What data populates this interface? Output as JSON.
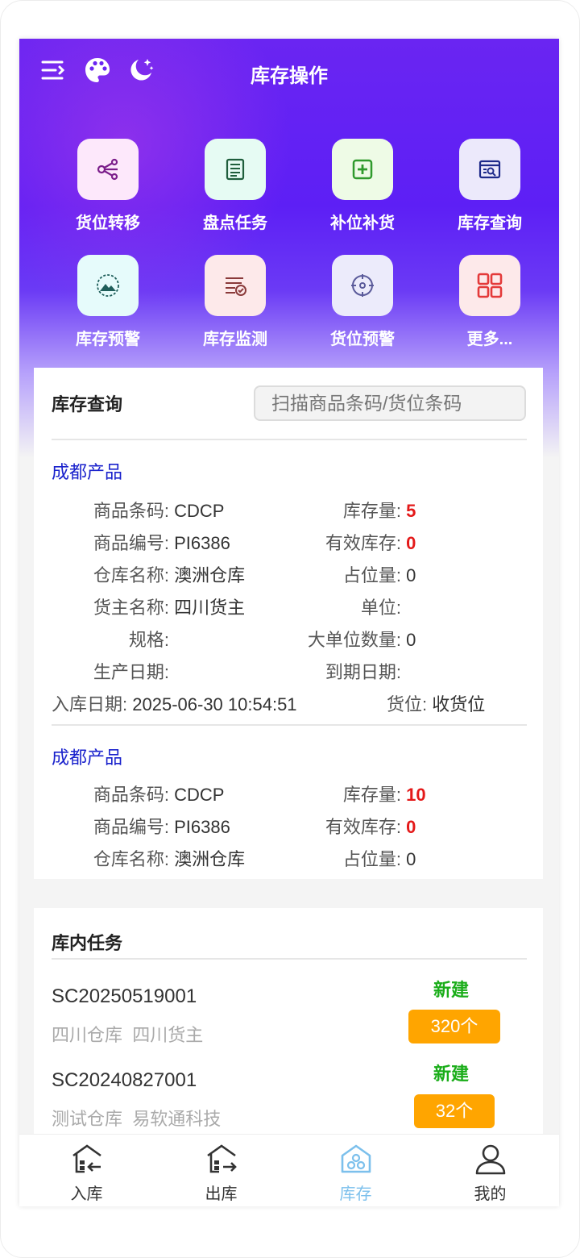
{
  "header": {
    "title": "库存操作"
  },
  "menu": [
    {
      "label": "货位转移",
      "icon": "share-nodes-icon",
      "bg": "#fde8fb",
      "fg": "#7b1e8a"
    },
    {
      "label": "盘点任务",
      "icon": "checklist-icon",
      "bg": "#e6fbf3",
      "fg": "#1f5e3c"
    },
    {
      "label": "补位补货",
      "icon": "plus-square-icon",
      "bg": "#eefbe6",
      "fg": "#2f9a2c"
    },
    {
      "label": "库存查询",
      "icon": "search-window-icon",
      "bg": "#ece9fb",
      "fg": "#1e2a8a"
    },
    {
      "label": "库存预警",
      "icon": "radar-mountain-icon",
      "bg": "#e6fbfb",
      "fg": "#1f5e5a"
    },
    {
      "label": "库存监测",
      "icon": "doc-check-icon",
      "bg": "#fde9ea",
      "fg": "#8a3a3a"
    },
    {
      "label": "货位预警",
      "icon": "target-icon",
      "bg": "#ecebfb",
      "fg": "#5a5a9a"
    },
    {
      "label": "更多...",
      "icon": "grid-four-icon",
      "bg": "#fde9ea",
      "fg": "#e43a3a"
    }
  ],
  "inventory": {
    "title": "库存查询",
    "search_placeholder": "扫描商品条码/货位条码",
    "records": [
      {
        "name": "成都产品",
        "barcode_label": "商品条码:",
        "barcode": "CDCP",
        "stock_label": "库存量:",
        "stock": "5",
        "code_label": "商品编号:",
        "code": "PI6386",
        "valid_label": "有效库存:",
        "valid": "0",
        "warehouse_label": "仓库名称:",
        "warehouse": "澳洲仓库",
        "occupied_label": "占位量:",
        "occupied": "0",
        "owner_label": "货主名称:",
        "owner": "四川货主",
        "unit_label": "单位:",
        "unit": "",
        "spec_label": "规格:",
        "spec": "",
        "big_unit_label": "大单位数量:",
        "big_unit": "0",
        "prod_date_label": "生产日期:",
        "prod_date": "",
        "exp_date_label": "到期日期:",
        "exp_date": "",
        "in_date_label": "入库日期:",
        "in_date": "2025-06-30 10:54:51",
        "location_label": "货位:",
        "location": "收货位"
      },
      {
        "name": "成都产品",
        "barcode_label": "商品条码:",
        "barcode": "CDCP",
        "stock_label": "库存量:",
        "stock": "10",
        "code_label": "商品编号:",
        "code": "PI6386",
        "valid_label": "有效库存:",
        "valid": "0",
        "warehouse_label": "仓库名称:",
        "warehouse": "澳洲仓库",
        "occupied_label": "占位量:",
        "occupied": "0"
      }
    ]
  },
  "tasks": {
    "title": "库内任务",
    "items": [
      {
        "code": "SC20250519001",
        "warehouse": "四川仓库",
        "owner": "四川货主",
        "status": "新建",
        "qty": "320个"
      },
      {
        "code": "SC20240827001",
        "warehouse": "测试仓库",
        "owner": "易软通科技",
        "status": "新建",
        "qty": "32个"
      }
    ]
  },
  "tabbar": [
    {
      "label": "入库",
      "icon": "warehouse-in-icon",
      "active": false
    },
    {
      "label": "出库",
      "icon": "warehouse-out-icon",
      "active": false
    },
    {
      "label": "库存",
      "icon": "warehouse-stock-icon",
      "active": true
    },
    {
      "label": "我的",
      "icon": "user-icon",
      "active": false
    }
  ],
  "colors": {
    "accent": "#5d1ff5",
    "link": "#1a22cc",
    "warn": "#e41919",
    "status": "#1aad19",
    "badge": "#ffa500",
    "tab_active": "#7cc0ec"
  }
}
